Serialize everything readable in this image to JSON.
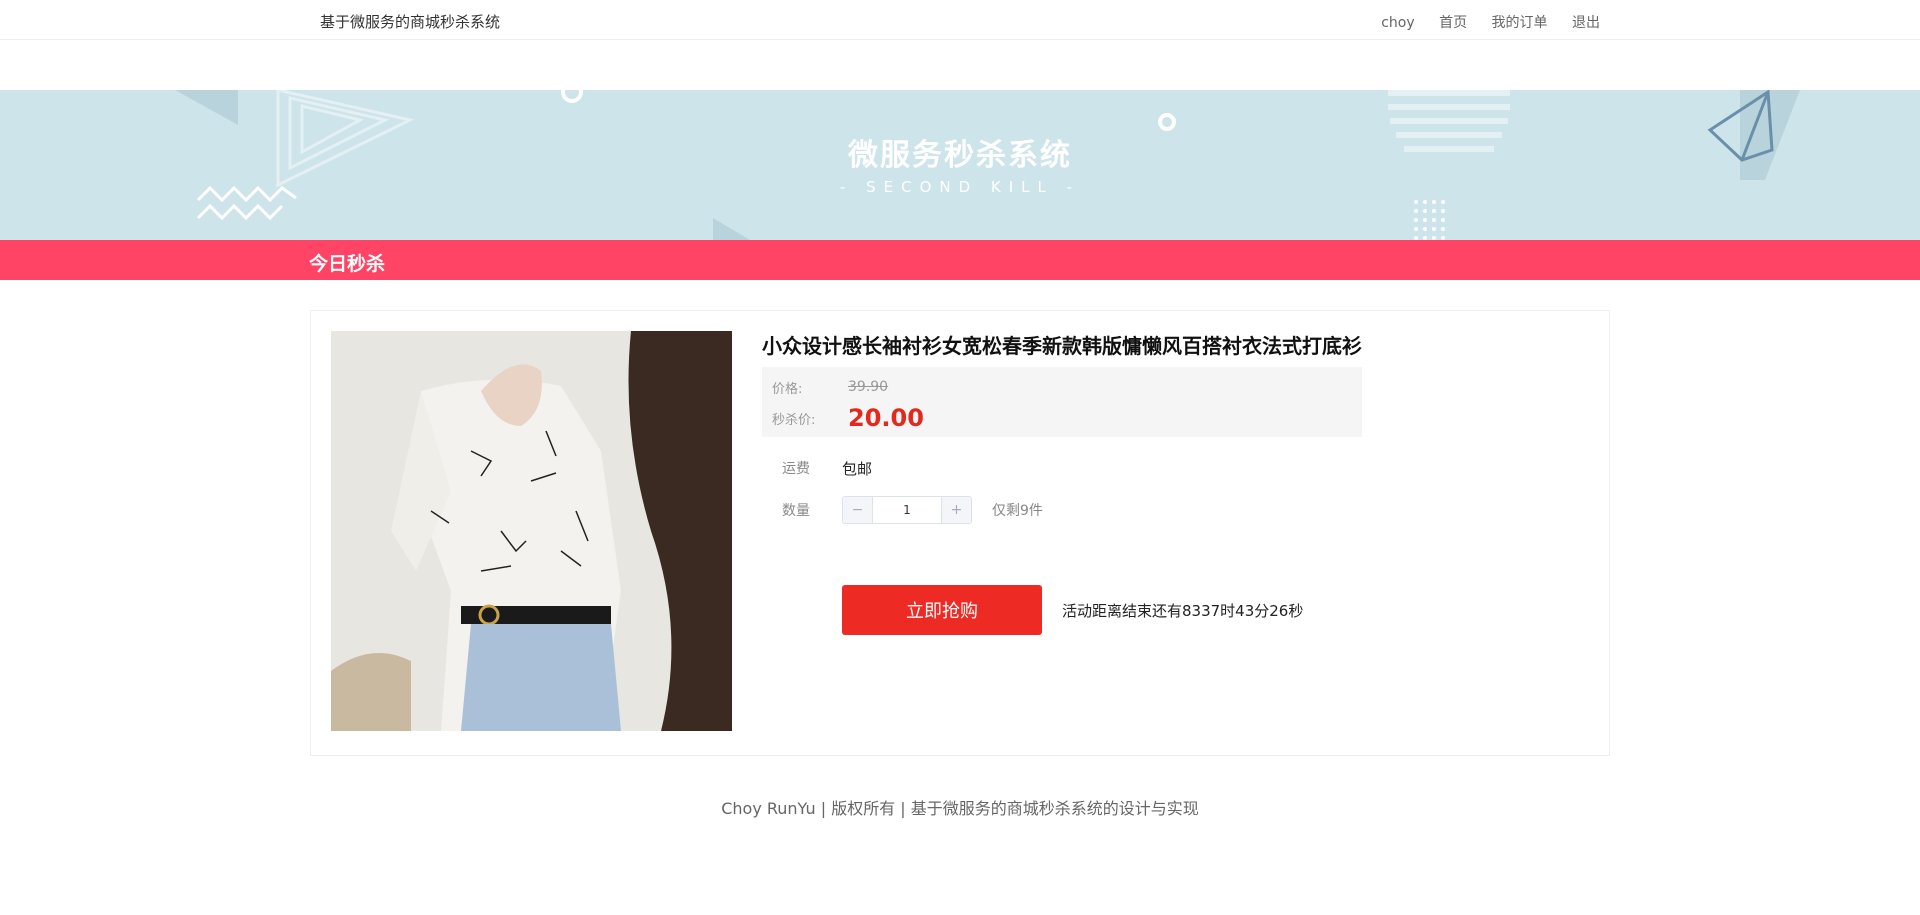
{
  "header": {
    "site_title": "基于微服务的商城秒杀系统",
    "nav": {
      "user": "choy",
      "home": "首页",
      "orders": "我的订单",
      "logout": "退出"
    }
  },
  "banner": {
    "title": "微服务秒杀系统",
    "subtitle": "-   SECOND  KILL   -"
  },
  "section": {
    "label": "今日秒杀"
  },
  "product": {
    "name": "小众设计感长袖衬衫女宽松春季新款韩版慵懒风百搭衬衣法式打底衫",
    "price_label": "价格:",
    "original_price": "39.90",
    "seckill_label": "秒杀价:",
    "seckill_price": "20.00",
    "shipping_label": "运费",
    "shipping_value": "包邮",
    "quantity_label": "数量",
    "quantity": "1",
    "minus": "−",
    "plus": "+",
    "stock_text": "仅剩9件",
    "buy_label": "立即抢购",
    "countdown_text": "活动距离结束还有8337时43分26秒"
  },
  "footer": {
    "text": "Choy RunYu | 版权所有 | 基于微服务的商城秒杀系统的设计与实现"
  },
  "colors": {
    "banner_bg": "#cde4ea",
    "accent_bar": "#ff4466",
    "buy_button": "#ee2a24",
    "seckill_price": "#e4281e"
  }
}
